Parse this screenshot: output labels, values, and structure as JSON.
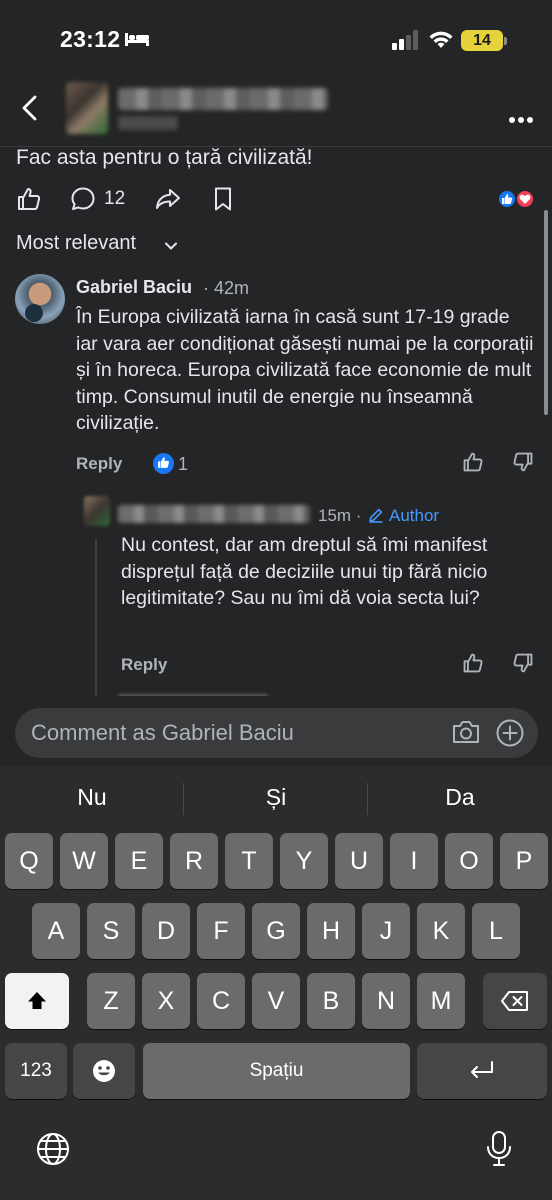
{
  "status_bar": {
    "time": "23:12",
    "battery": "14",
    "icons": [
      "bed-icon",
      "signal-icon",
      "wifi-icon",
      "battery-icon"
    ]
  },
  "header": {
    "icons": [
      "back-chevron-icon",
      "more-options-icon"
    ]
  },
  "post": {
    "text": "Fac asta pentru o țară civilizată!",
    "comment_count": "12"
  },
  "comments": {
    "sort_label": "Most relevant",
    "items": [
      {
        "name": "Gabriel Baciu",
        "time": "· 42m",
        "text": "În Europa civilizată iarna în casă sunt 17-19 grade iar vara aer condiționat găsești numai pe la corporații și în horeca. Europa civilizată face economie de mult timp. Consumul inutil de energie nu înseamnă civilizație.",
        "reply_label": "Reply",
        "reaction_count": "1"
      },
      {
        "time": "15m ·",
        "author_badge": "Author",
        "text": "Nu contest, dar am dreptul să îmi manifest disprețul față de deciziile unui tip fără nicio legitimitate? Sau nu îmi dă voia secta lui?",
        "reply_label": "Reply"
      }
    ]
  },
  "composer": {
    "placeholder": "Comment as Gabriel Baciu"
  },
  "keyboard": {
    "suggestions": [
      "Nu",
      "Și",
      "Da"
    ],
    "row1": [
      "Q",
      "W",
      "E",
      "R",
      "T",
      "Y",
      "U",
      "I",
      "O",
      "P"
    ],
    "row2": [
      "A",
      "S",
      "D",
      "F",
      "G",
      "H",
      "J",
      "K",
      "L"
    ],
    "row3": [
      "Z",
      "X",
      "C",
      "V",
      "B",
      "N",
      "M"
    ],
    "numbers_key": "123",
    "space_key": "Spațiu"
  },
  "colors": {
    "background": "#242526",
    "accent_blue": "#1877f2",
    "author_blue": "#4599ff",
    "love_red": "#f33e58"
  }
}
